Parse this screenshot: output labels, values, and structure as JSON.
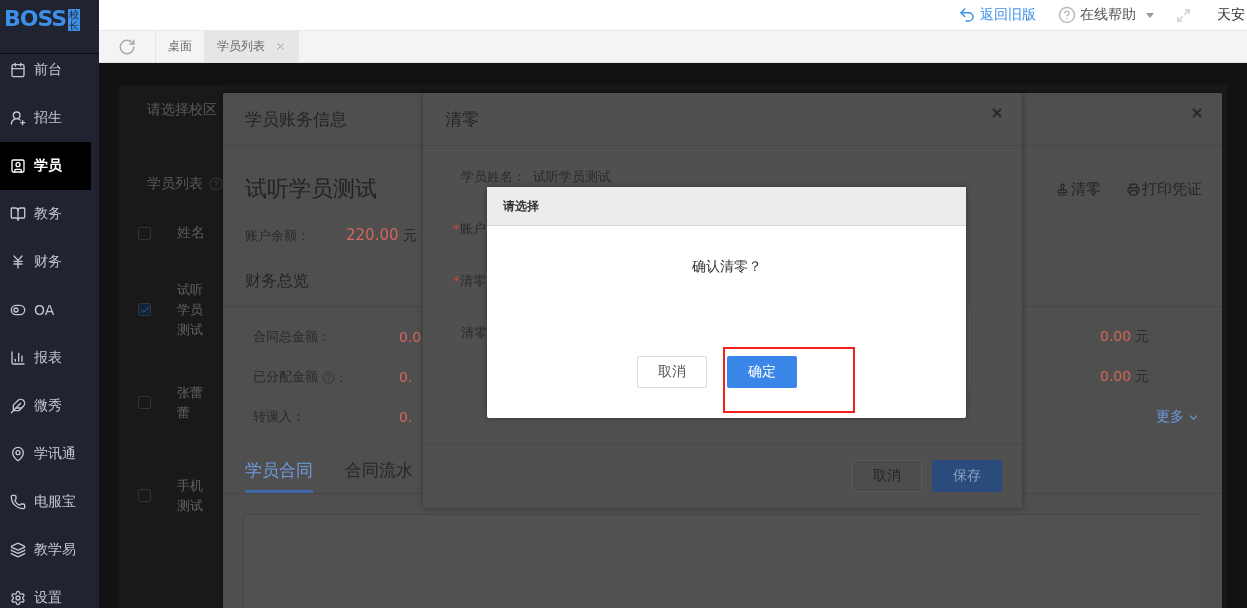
{
  "logo": {
    "text": "BOSS",
    "tag": "校长"
  },
  "sidebar": {
    "items": [
      {
        "label": "前台",
        "selected": false
      },
      {
        "label": "招生",
        "selected": false
      },
      {
        "label": "学员",
        "selected": true
      },
      {
        "label": "教务",
        "selected": false
      },
      {
        "label": "财务",
        "selected": false
      },
      {
        "label": "OA",
        "selected": false
      },
      {
        "label": "报表",
        "selected": false
      },
      {
        "label": "微秀",
        "selected": false
      },
      {
        "label": "学讯通",
        "selected": false
      },
      {
        "label": "电服宝",
        "selected": false
      },
      {
        "label": "教学易",
        "selected": false
      },
      {
        "label": "设置",
        "selected": false
      }
    ]
  },
  "header": {
    "links": [
      {
        "label": "返回旧版",
        "kind": "back"
      },
      {
        "label": "在线帮助",
        "kind": "help"
      }
    ],
    "user": "天安"
  },
  "tabs": [
    {
      "label": "桌面",
      "selected": false,
      "closable": false
    },
    {
      "label": "学员列表",
      "selected": true,
      "closable": true
    }
  ],
  "page": {
    "campus_select": "请选择校区",
    "list_title": "学员列表",
    "header_checked": false,
    "columns": [
      "姓名"
    ],
    "rows": [
      {
        "name": "试听学员测试",
        "checked": true
      },
      {
        "name": "张蕾蕾",
        "checked": false
      },
      {
        "name": "手机测试",
        "checked": false
      }
    ]
  },
  "account_dialog": {
    "title": "学员账务信息",
    "student_name": "试听学员测试",
    "balance_label": "账户余额：",
    "balance_value": "220.00",
    "balance_unit": "元",
    "actions": [
      {
        "label": "清零",
        "kind": "clear"
      },
      {
        "label": "打印凭证",
        "kind": "print"
      }
    ],
    "overview_title": "财务总览",
    "stats": [
      {
        "label": "合同总金额：",
        "help": false,
        "value": "0.0",
        "value_2": "0.00",
        "unit_2": "元"
      },
      {
        "label": "已分配金额",
        "help": true,
        "colon": ":",
        "value": "0.",
        "value_2": "0.00",
        "unit_2": "元"
      },
      {
        "label": "转课入：",
        "help": false,
        "value": "0."
      }
    ],
    "more": "更多",
    "tabs": [
      {
        "label": "学员合同",
        "selected": true
      },
      {
        "label": "合同流水",
        "selected": false
      }
    ]
  },
  "clear_dialog": {
    "title": "清零",
    "fields": [
      {
        "label": "学员姓名：",
        "value": "试听学员测试"
      },
      {
        "mark": "*",
        "label": "账户"
      },
      {
        "mark": "*",
        "label": "清零"
      },
      {
        "label": "清零",
        "kind": "textarea"
      }
    ],
    "buttons": [
      {
        "label": "取消",
        "kind": "secondary"
      },
      {
        "label": "保存",
        "kind": "primary"
      }
    ]
  },
  "confirm_dialog": {
    "title": "请选择",
    "message": "确认清零？",
    "buttons": [
      {
        "label": "取消",
        "kind": "secondary",
        "highlight": false
      },
      {
        "label": "确定",
        "kind": "primary",
        "highlight": true
      }
    ]
  }
}
